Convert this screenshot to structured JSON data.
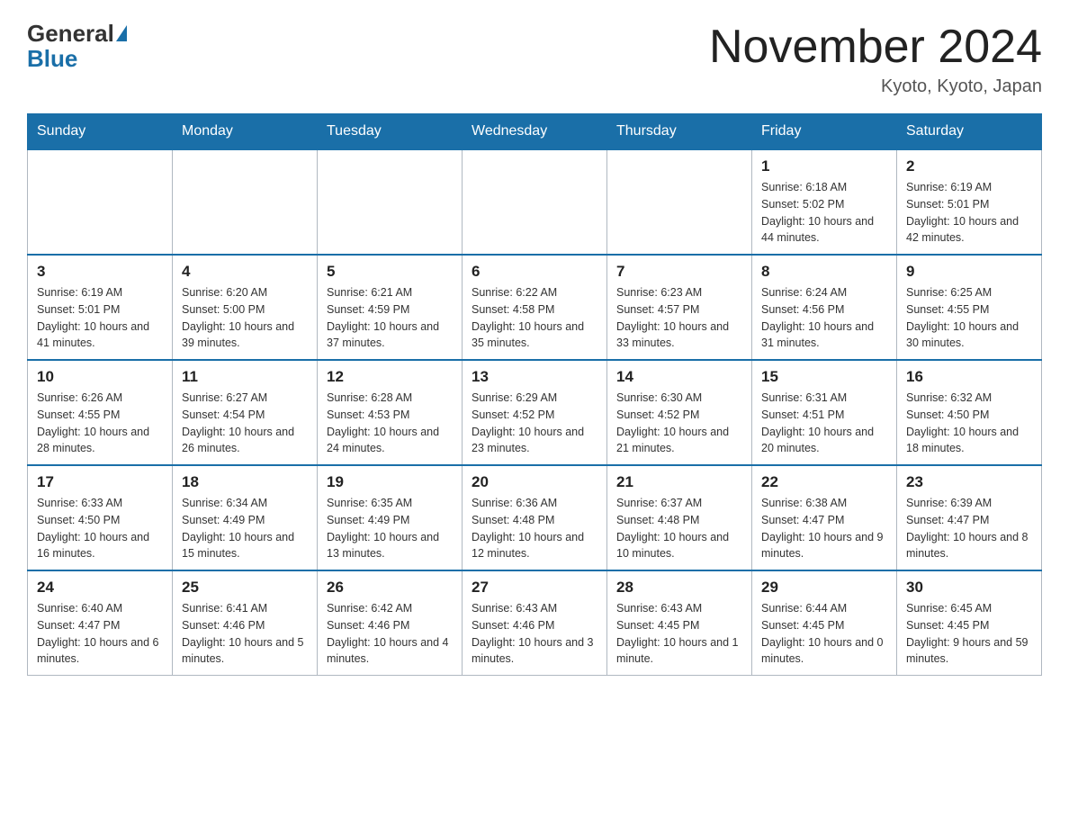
{
  "header": {
    "logo": {
      "part1": "General",
      "part2": "Blue"
    },
    "title": "November 2024",
    "location": "Kyoto, Kyoto, Japan"
  },
  "days_of_week": [
    "Sunday",
    "Monday",
    "Tuesday",
    "Wednesday",
    "Thursday",
    "Friday",
    "Saturday"
  ],
  "weeks": [
    [
      {
        "day": "",
        "info": ""
      },
      {
        "day": "",
        "info": ""
      },
      {
        "day": "",
        "info": ""
      },
      {
        "day": "",
        "info": ""
      },
      {
        "day": "",
        "info": ""
      },
      {
        "day": "1",
        "info": "Sunrise: 6:18 AM\nSunset: 5:02 PM\nDaylight: 10 hours and 44 minutes."
      },
      {
        "day": "2",
        "info": "Sunrise: 6:19 AM\nSunset: 5:01 PM\nDaylight: 10 hours and 42 minutes."
      }
    ],
    [
      {
        "day": "3",
        "info": "Sunrise: 6:19 AM\nSunset: 5:01 PM\nDaylight: 10 hours and 41 minutes."
      },
      {
        "day": "4",
        "info": "Sunrise: 6:20 AM\nSunset: 5:00 PM\nDaylight: 10 hours and 39 minutes."
      },
      {
        "day": "5",
        "info": "Sunrise: 6:21 AM\nSunset: 4:59 PM\nDaylight: 10 hours and 37 minutes."
      },
      {
        "day": "6",
        "info": "Sunrise: 6:22 AM\nSunset: 4:58 PM\nDaylight: 10 hours and 35 minutes."
      },
      {
        "day": "7",
        "info": "Sunrise: 6:23 AM\nSunset: 4:57 PM\nDaylight: 10 hours and 33 minutes."
      },
      {
        "day": "8",
        "info": "Sunrise: 6:24 AM\nSunset: 4:56 PM\nDaylight: 10 hours and 31 minutes."
      },
      {
        "day": "9",
        "info": "Sunrise: 6:25 AM\nSunset: 4:55 PM\nDaylight: 10 hours and 30 minutes."
      }
    ],
    [
      {
        "day": "10",
        "info": "Sunrise: 6:26 AM\nSunset: 4:55 PM\nDaylight: 10 hours and 28 minutes."
      },
      {
        "day": "11",
        "info": "Sunrise: 6:27 AM\nSunset: 4:54 PM\nDaylight: 10 hours and 26 minutes."
      },
      {
        "day": "12",
        "info": "Sunrise: 6:28 AM\nSunset: 4:53 PM\nDaylight: 10 hours and 24 minutes."
      },
      {
        "day": "13",
        "info": "Sunrise: 6:29 AM\nSunset: 4:52 PM\nDaylight: 10 hours and 23 minutes."
      },
      {
        "day": "14",
        "info": "Sunrise: 6:30 AM\nSunset: 4:52 PM\nDaylight: 10 hours and 21 minutes."
      },
      {
        "day": "15",
        "info": "Sunrise: 6:31 AM\nSunset: 4:51 PM\nDaylight: 10 hours and 20 minutes."
      },
      {
        "day": "16",
        "info": "Sunrise: 6:32 AM\nSunset: 4:50 PM\nDaylight: 10 hours and 18 minutes."
      }
    ],
    [
      {
        "day": "17",
        "info": "Sunrise: 6:33 AM\nSunset: 4:50 PM\nDaylight: 10 hours and 16 minutes."
      },
      {
        "day": "18",
        "info": "Sunrise: 6:34 AM\nSunset: 4:49 PM\nDaylight: 10 hours and 15 minutes."
      },
      {
        "day": "19",
        "info": "Sunrise: 6:35 AM\nSunset: 4:49 PM\nDaylight: 10 hours and 13 minutes."
      },
      {
        "day": "20",
        "info": "Sunrise: 6:36 AM\nSunset: 4:48 PM\nDaylight: 10 hours and 12 minutes."
      },
      {
        "day": "21",
        "info": "Sunrise: 6:37 AM\nSunset: 4:48 PM\nDaylight: 10 hours and 10 minutes."
      },
      {
        "day": "22",
        "info": "Sunrise: 6:38 AM\nSunset: 4:47 PM\nDaylight: 10 hours and 9 minutes."
      },
      {
        "day": "23",
        "info": "Sunrise: 6:39 AM\nSunset: 4:47 PM\nDaylight: 10 hours and 8 minutes."
      }
    ],
    [
      {
        "day": "24",
        "info": "Sunrise: 6:40 AM\nSunset: 4:47 PM\nDaylight: 10 hours and 6 minutes."
      },
      {
        "day": "25",
        "info": "Sunrise: 6:41 AM\nSunset: 4:46 PM\nDaylight: 10 hours and 5 minutes."
      },
      {
        "day": "26",
        "info": "Sunrise: 6:42 AM\nSunset: 4:46 PM\nDaylight: 10 hours and 4 minutes."
      },
      {
        "day": "27",
        "info": "Sunrise: 6:43 AM\nSunset: 4:46 PM\nDaylight: 10 hours and 3 minutes."
      },
      {
        "day": "28",
        "info": "Sunrise: 6:43 AM\nSunset: 4:45 PM\nDaylight: 10 hours and 1 minute."
      },
      {
        "day": "29",
        "info": "Sunrise: 6:44 AM\nSunset: 4:45 PM\nDaylight: 10 hours and 0 minutes."
      },
      {
        "day": "30",
        "info": "Sunrise: 6:45 AM\nSunset: 4:45 PM\nDaylight: 9 hours and 59 minutes."
      }
    ]
  ]
}
